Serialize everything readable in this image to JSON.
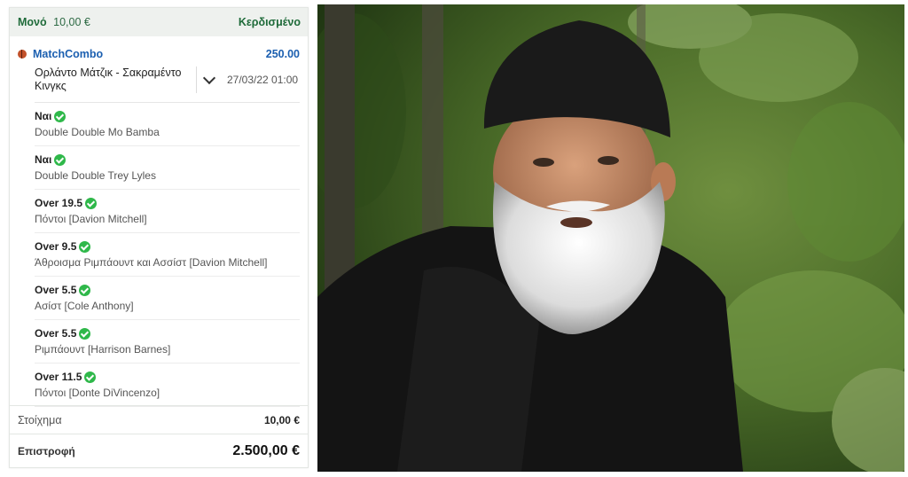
{
  "slip": {
    "bet_type": "Μονό",
    "stake_header": "10,00 €",
    "status": "Κερδισμένο",
    "combo_name": "MatchCombo",
    "combo_odds": "250.00",
    "event_name": "Ορλάντο Μάτζικ - Σακραμέντο Κινγκς",
    "event_date": "27/03/22 01:00",
    "selections": [
      {
        "pick": "Ναι",
        "market": "Double Double Mo Bamba"
      },
      {
        "pick": "Ναι",
        "market": "Double Double Trey Lyles"
      },
      {
        "pick": "Over 19.5",
        "market": "Πόντοι [Davion Mitchell]"
      },
      {
        "pick": "Over 9.5",
        "market": "Άθροισμα Ριμπάουντ και Ασσίστ [Davion Mitchell]"
      },
      {
        "pick": "Over 5.5",
        "market": "Ασίστ [Cole Anthony]"
      },
      {
        "pick": "Over 5.5",
        "market": "Ριμπάουντ [Harrison Barnes]"
      },
      {
        "pick": "Over 11.5",
        "market": "Πόντοι [Donte DiVincenzo]"
      }
    ],
    "stake_label": "Στοίχημα",
    "stake_value": "10,00 €",
    "return_label": "Επιστροφή",
    "return_value": "2.500,00 €"
  },
  "colors": {
    "win_green": "#1f6b3a",
    "odds_blue": "#1b5fb0",
    "check_green": "#2fb84a"
  },
  "icons": [
    "basketball-icon",
    "chevron-down-icon",
    "check-circle-icon"
  ]
}
